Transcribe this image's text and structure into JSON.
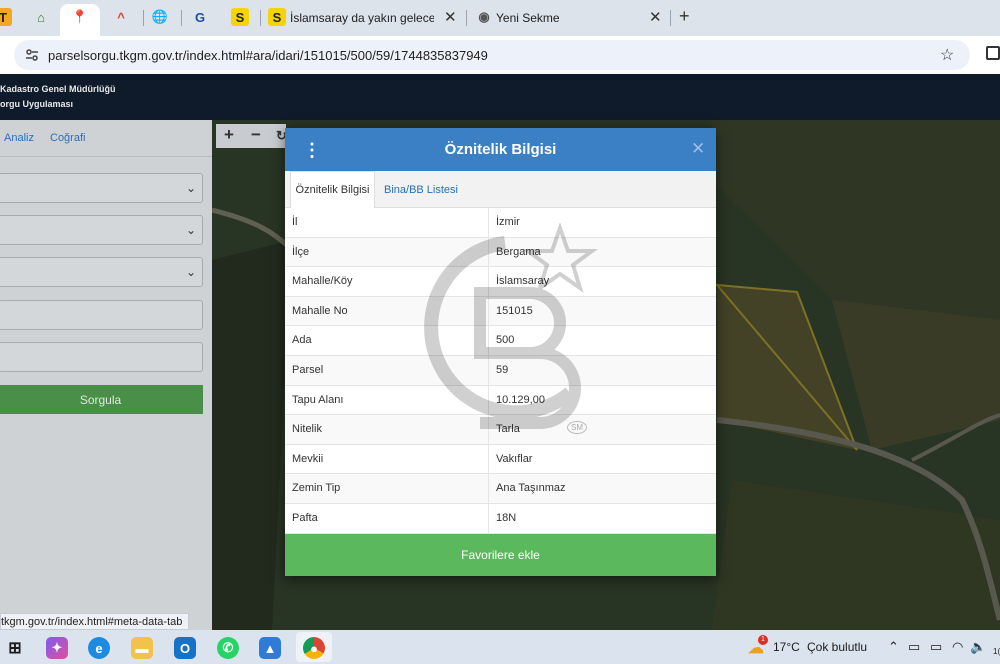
{
  "browser": {
    "tabs": [
      {
        "title": "İslamsaray da yakın geleceği pa"
      },
      {
        "title": "Yeni Sekme"
      }
    ],
    "url": "parselsorgu.tkgm.gov.tr/index.html#ara/idari/151015/500/59/1744835837949",
    "new_tab": "+",
    "close_glyph": "✕"
  },
  "site": {
    "header_line1": "Kadastro Genel Müdürlüğü",
    "header_line2": "orgu Uygulaması"
  },
  "left_panel": {
    "links": [
      "Analiz",
      "Coğrafi"
    ],
    "query_button": "Sorgula"
  },
  "map_controls": {
    "zoom_in": "+",
    "zoom_out": "−"
  },
  "modal": {
    "title": "Öznitelik Bilgisi",
    "tabs": [
      "Öznitelik Bilgisi",
      "Bina/BB Listesi"
    ],
    "rows": [
      {
        "key": "İl",
        "value": "İzmir"
      },
      {
        "key": "İlçe",
        "value": "Bergama"
      },
      {
        "key": "Mahalle/Köy",
        "value": "İslamsaray"
      },
      {
        "key": "Mahalle No",
        "value": "151015"
      },
      {
        "key": "Ada",
        "value": "500"
      },
      {
        "key": "Parsel",
        "value": "59"
      },
      {
        "key": "Tapu Alanı",
        "value": "10.129,00"
      },
      {
        "key": "Nitelik",
        "value": "Tarla"
      },
      {
        "key": "Mevkii",
        "value": "Vakıflar"
      },
      {
        "key": "Zemin Tip",
        "value": "Ana Taşınmaz"
      },
      {
        "key": "Pafta",
        "value": "18N"
      }
    ],
    "favorite_button": "Favorilere ekle",
    "watermark_mark": "SM"
  },
  "status_bar": {
    "url": "tkgm.gov.tr/index.html#meta-data-tab"
  },
  "taskbar": {
    "weather_temp": "17°C",
    "weather_text": "Çok bulutlu",
    "weather_badge": "1",
    "clock": "1("
  },
  "colors": {
    "modal_header": "#3b7fc4",
    "favorite_button": "#5cb85c",
    "query_button": "#4a8f48",
    "site_header": "#0f1b2a"
  }
}
